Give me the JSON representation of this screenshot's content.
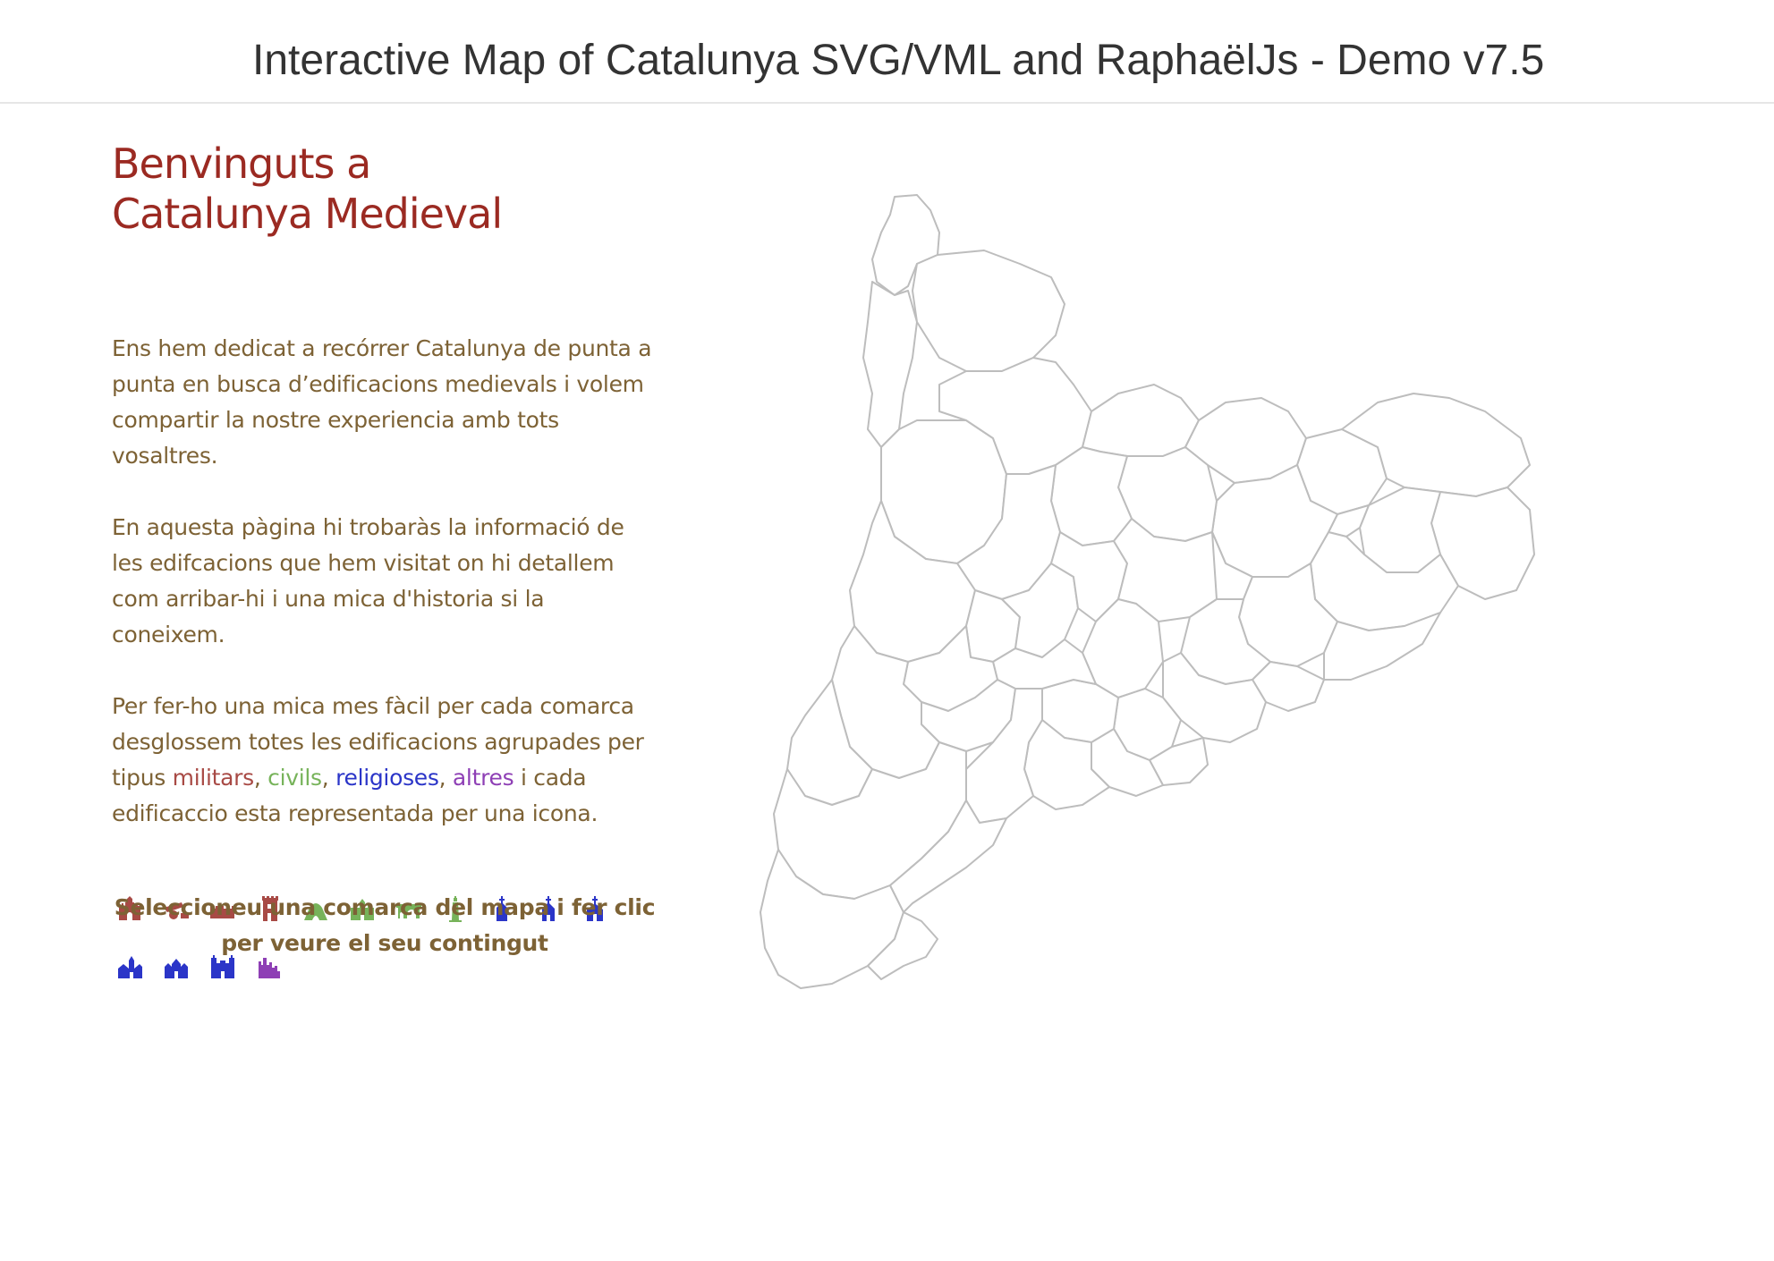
{
  "header": {
    "title": "Interactive Map of Catalunya SVG/VML and RaphaëlJs - Demo v7.5"
  },
  "intro": {
    "title_line1": "Benvinguts a",
    "title_line2": "Catalunya Medieval",
    "paragraph1": "Ens hem dedicat a recórrer Catalunya de punta a punta en busca d’edificacions medievals i volem compartir la nostre experiencia amb tots vosaltres.",
    "paragraph2": "En aquesta pàgina hi trobaràs la informació de les edifcacions que hem visitat on hi detallem com arribar-hi i una mica d'historia si la coneixem.",
    "paragraph3_prefix": "Per fer-ho una mica mes fàcil per cada comarca desglossem totes les edificacions agrupades per tipus ",
    "cat_militars": "militars",
    "sep1": ", ",
    "cat_civils": "civils",
    "sep2": ", ",
    "cat_religioses": "religioses",
    "sep3": ", ",
    "cat_altres": "altres",
    "paragraph3_suffix": " i cada edificaccio esta representada per una icona.",
    "cta": "Seleccioneu una comarca del mapa i fer clic per veure el seu contingut"
  },
  "colors": {
    "militars": "#a84a45",
    "civils": "#77b35a",
    "religioses": "#2b35c8",
    "altres": "#8e3fb5",
    "map_stroke": "#bdbdbd"
  },
  "icons": [
    {
      "name": "castle-icon",
      "category": "militars"
    },
    {
      "name": "cannon-icon",
      "category": "militars"
    },
    {
      "name": "wall-icon",
      "category": "militars"
    },
    {
      "name": "tower-icon",
      "category": "militars"
    },
    {
      "name": "cave-icon",
      "category": "civils"
    },
    {
      "name": "palace-icon",
      "category": "civils"
    },
    {
      "name": "bridge-icon",
      "category": "civils"
    },
    {
      "name": "lighthouse-icon",
      "category": "civils"
    },
    {
      "name": "chapel-icon",
      "category": "religioses"
    },
    {
      "name": "church-icon",
      "category": "religioses"
    },
    {
      "name": "hermitage-icon",
      "category": "religioses"
    },
    {
      "name": "monastery-icon",
      "category": "religioses"
    },
    {
      "name": "cathedral-icon",
      "category": "religioses"
    },
    {
      "name": "basilica-icon",
      "category": "religioses"
    },
    {
      "name": "ruins-icon",
      "category": "altres"
    }
  ]
}
